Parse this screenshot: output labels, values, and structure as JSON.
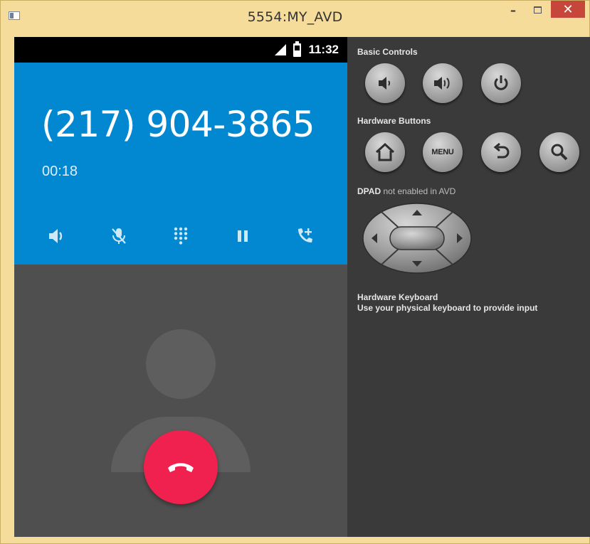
{
  "window": {
    "title": "5554:MY_AVD",
    "minimize_label": "–",
    "close_label": "✕"
  },
  "statusbar": {
    "time": "11:32"
  },
  "call": {
    "phone_number": "(217) 904-3865",
    "timer": "00:18",
    "actions": [
      "speaker-icon",
      "mute-icon",
      "dialpad-icon",
      "hold-icon",
      "add-call-icon"
    ]
  },
  "panel": {
    "basic_controls_label": "Basic Controls",
    "hardware_buttons_label": "Hardware Buttons",
    "menu_label": "MENU",
    "dpad_label": "DPAD",
    "dpad_note": "not enabled in AVD",
    "keyboard_title": "Hardware Keyboard",
    "keyboard_hint": "Use your physical keyboard to provide input"
  },
  "colors": {
    "call_header": "#0288d1",
    "end_call": "#f0204f",
    "panel_bg": "#3a3a3a",
    "window_frame": "#f5dc9a"
  }
}
